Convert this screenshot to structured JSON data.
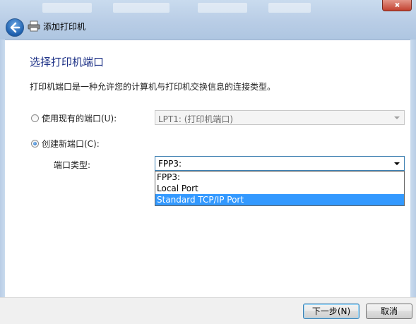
{
  "window": {
    "title": "添加打印机"
  },
  "page": {
    "heading": "选择打印机端口",
    "description": "打印机端口是一种允许您的计算机与打印机交换信息的连接类型。"
  },
  "existing_port": {
    "label": "使用现有的端口(U):",
    "selected": false,
    "value": "LPT1: (打印机端口)"
  },
  "new_port": {
    "label": "创建新端口(C):",
    "selected": true,
    "type_label": "端口类型:",
    "value": "FPP3:",
    "options": [
      "FPP3:",
      "Local Port",
      "Standard TCP/IP Port"
    ],
    "highlighted_option": "Standard TCP/IP Port"
  },
  "buttons": {
    "next": "下一步(N)",
    "cancel": "取消"
  },
  "icons": {
    "back": "back-arrow-icon",
    "printer": "printer-icon",
    "close": "close-icon",
    "dropdown": "chevron-down-icon"
  }
}
